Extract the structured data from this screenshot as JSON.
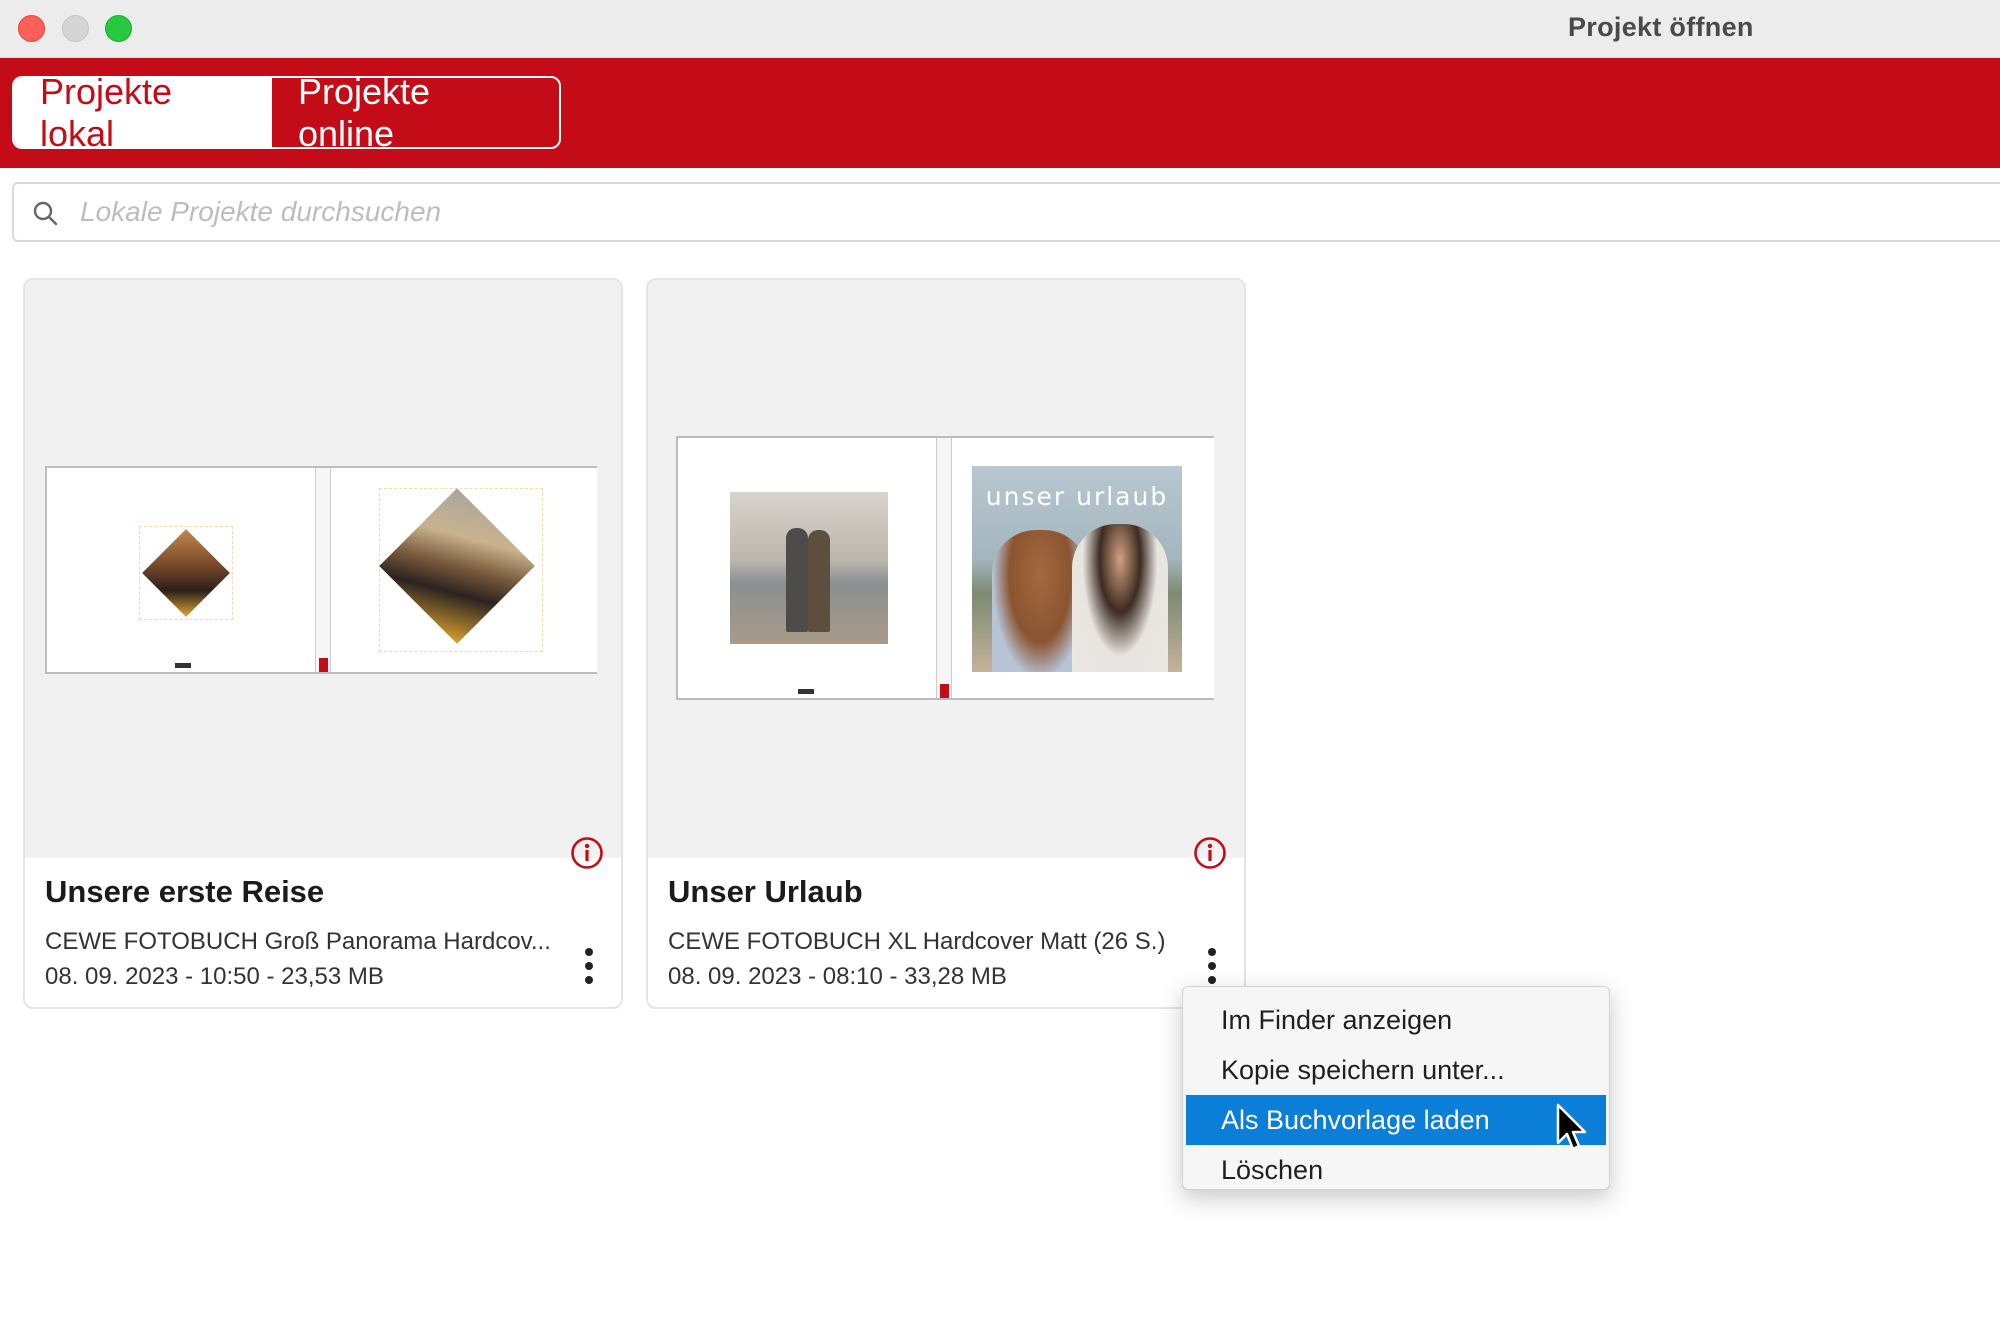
{
  "window": {
    "title": "Projekt öffnen"
  },
  "tabs": [
    {
      "label": "Projekte lokal",
      "active": true
    },
    {
      "label": "Projekte online",
      "active": false
    }
  ],
  "search": {
    "placeholder": "Lokale Projekte durchsuchen",
    "value": ""
  },
  "projects": [
    {
      "title": "Unsere erste Reise",
      "description": "CEWE FOTOBUCH Groß Panorama Hardcov...",
      "meta": "08. 09. 2023 - 10:50 -  23,53 MB"
    },
    {
      "title": "Unser Urlaub",
      "description": "CEWE FOTOBUCH XL Hardcover Matt (26 S.)",
      "meta": "08. 09. 2023 - 08:10 -  33,28 MB",
      "cover_text": "unser urlaub"
    }
  ],
  "context_menu": {
    "items": [
      {
        "label": "Im Finder anzeigen",
        "highlighted": false
      },
      {
        "label": "Kopie speichern unter...",
        "highlighted": false
      },
      {
        "label": "Als Buchvorlage laden",
        "highlighted": true
      },
      {
        "label": "Löschen",
        "highlighted": false
      }
    ]
  },
  "colors": {
    "brand_red": "#c30c17",
    "menu_highlight": "#0b7ed7",
    "card_thumb_bg": "#f1f1f1"
  },
  "icons": [
    "search-icon",
    "info-icon",
    "more-vertical-icon",
    "pointer-cursor-icon"
  ]
}
